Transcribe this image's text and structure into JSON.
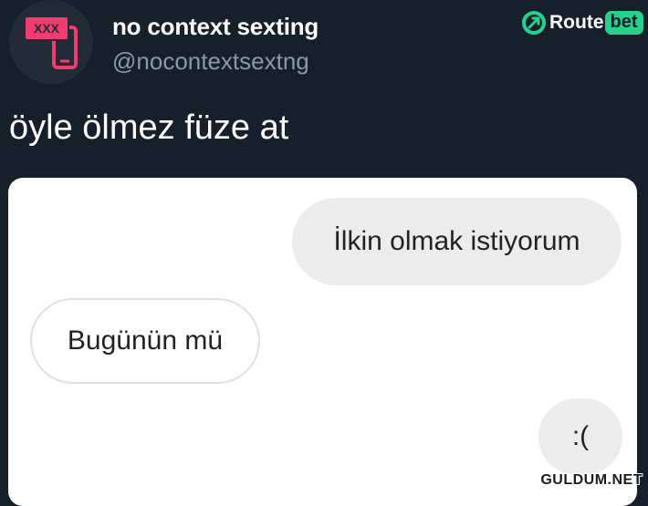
{
  "profile": {
    "display_name": "no context sexting",
    "handle": "@nocontextsextng",
    "avatar_badge_text": "XXX",
    "avatar_icon": "phone-icon"
  },
  "brand": {
    "word": "Route",
    "pill": "bet",
    "icon": "routebet-logo-icon",
    "accent_color": "#27d18b"
  },
  "tweet": {
    "text": "öyle ölmez füze at"
  },
  "chat": {
    "messages": [
      {
        "side": "sent",
        "text": "İlkin olmak istiyorum"
      },
      {
        "side": "received",
        "text": "Bugünün mü"
      },
      {
        "side": "sent",
        "text": ":("
      }
    ]
  },
  "watermark": {
    "text": "GULDUM.NET"
  },
  "colors": {
    "background": "#16202b",
    "handle": "#8a98a8",
    "sent_bubble": "#ececec",
    "received_border": "#e1e1e1",
    "avatar_accent": "#ef3d6f"
  }
}
